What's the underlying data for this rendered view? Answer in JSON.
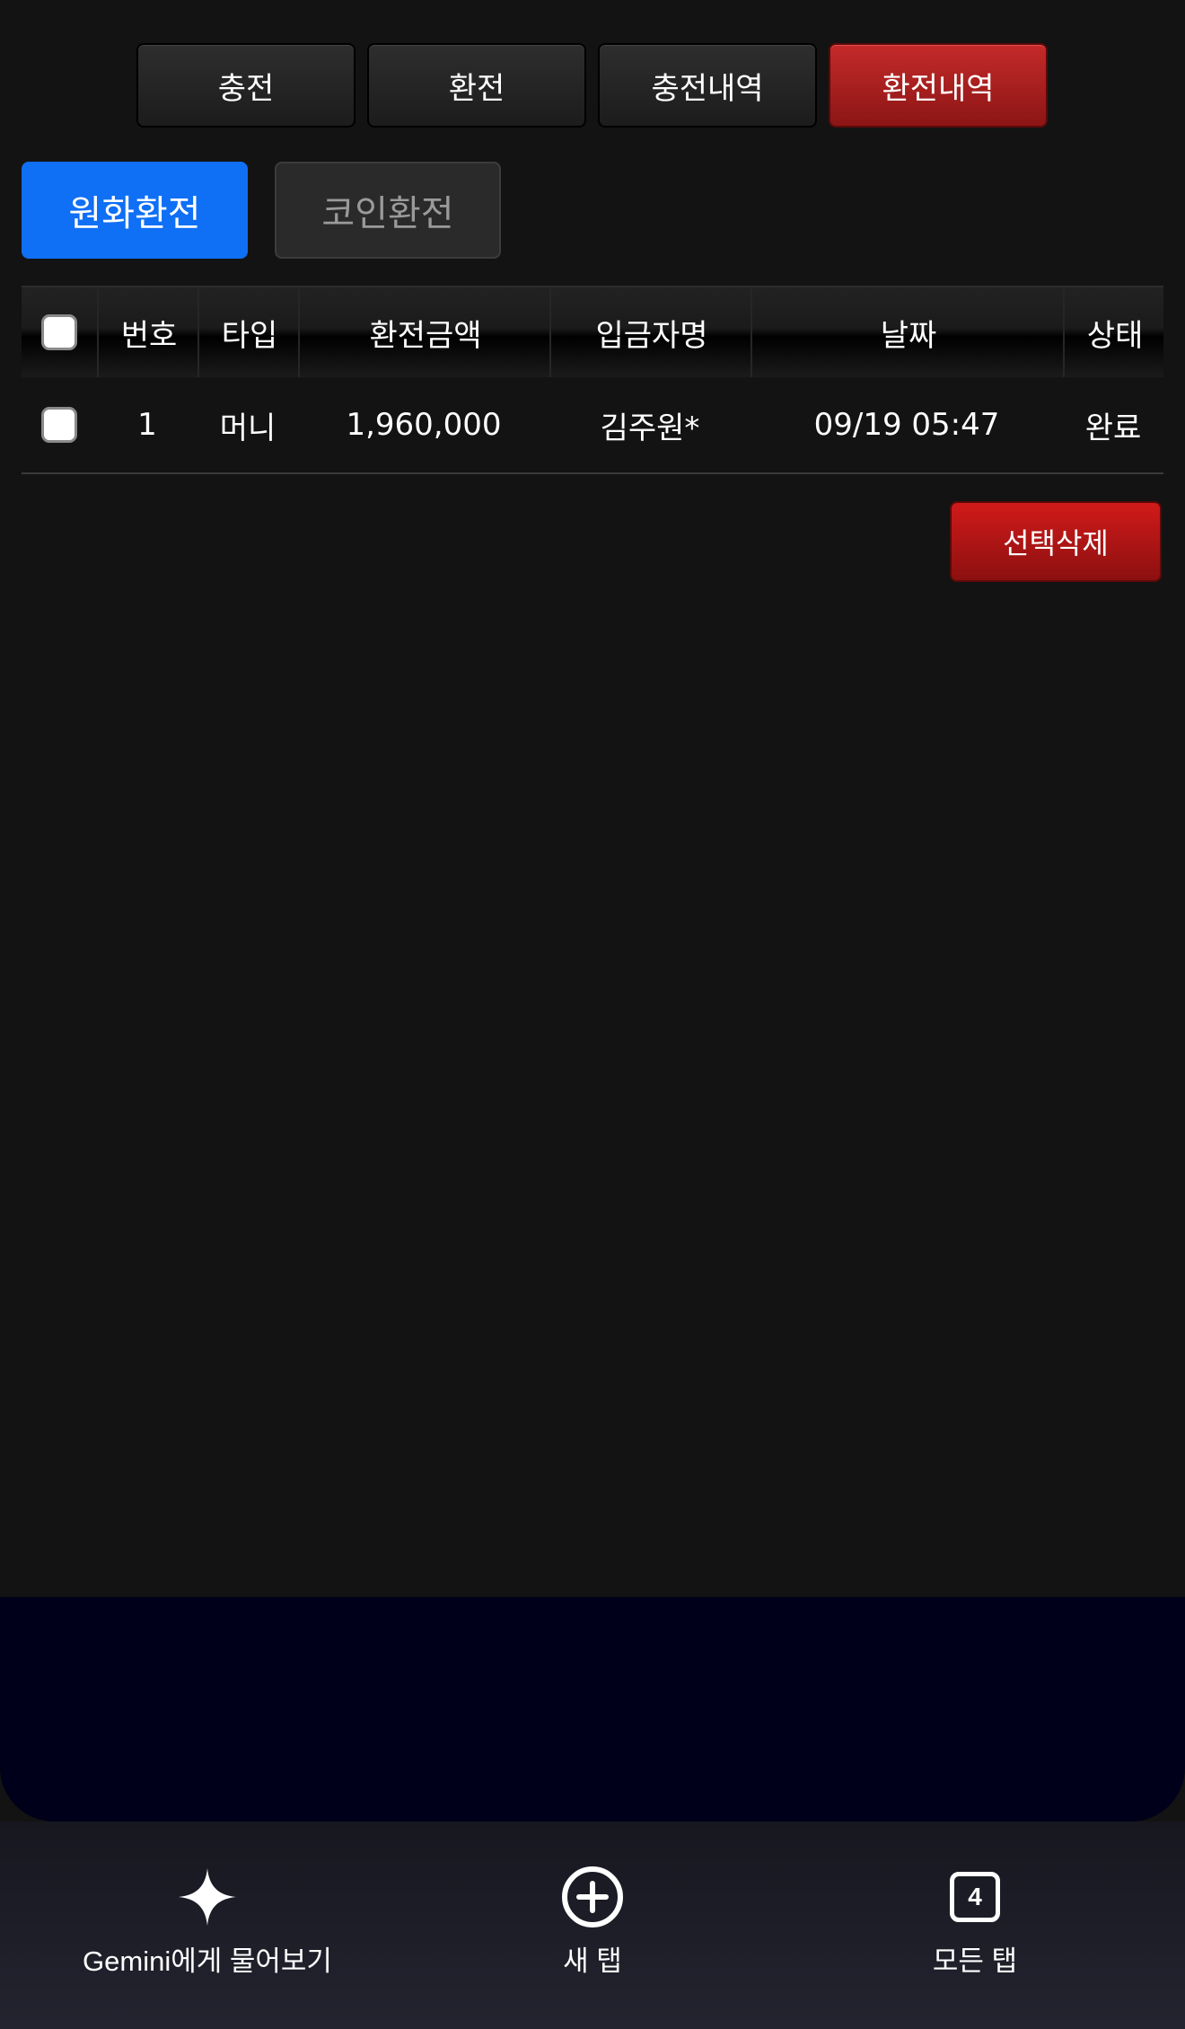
{
  "top_tabs": [
    {
      "label": "충전",
      "active": false
    },
    {
      "label": "환전",
      "active": false
    },
    {
      "label": "충전내역",
      "active": false
    },
    {
      "label": "환전내역",
      "active": true
    }
  ],
  "sub_tabs": [
    {
      "label": "원화환전",
      "active": true
    },
    {
      "label": "코인환전",
      "active": false
    }
  ],
  "table": {
    "headers": [
      "번호",
      "타입",
      "환전금액",
      "입금자명",
      "날짜",
      "상태"
    ],
    "rows": [
      {
        "no": "1",
        "type": "머니",
        "amount": "1,960,000",
        "depositor": "김주원*",
        "date": "09/19 05:47",
        "status": "완료",
        "checked": false
      }
    ]
  },
  "delete_button": "선택삭제",
  "browser_bar": {
    "gemini_label": "Gemini에게 물어보기",
    "new_tab_label": "새 탭",
    "all_tabs_label": "모든 탭",
    "tab_count": "4"
  },
  "colors": {
    "background": "#131313",
    "active_red": "#b11f1f",
    "active_blue": "#0f6ff5",
    "navy": "#00001a"
  },
  "icons": [
    "gemini-sparkle-icon",
    "plus-circle-icon",
    "tab-count-icon",
    "checkbox-icon"
  ]
}
